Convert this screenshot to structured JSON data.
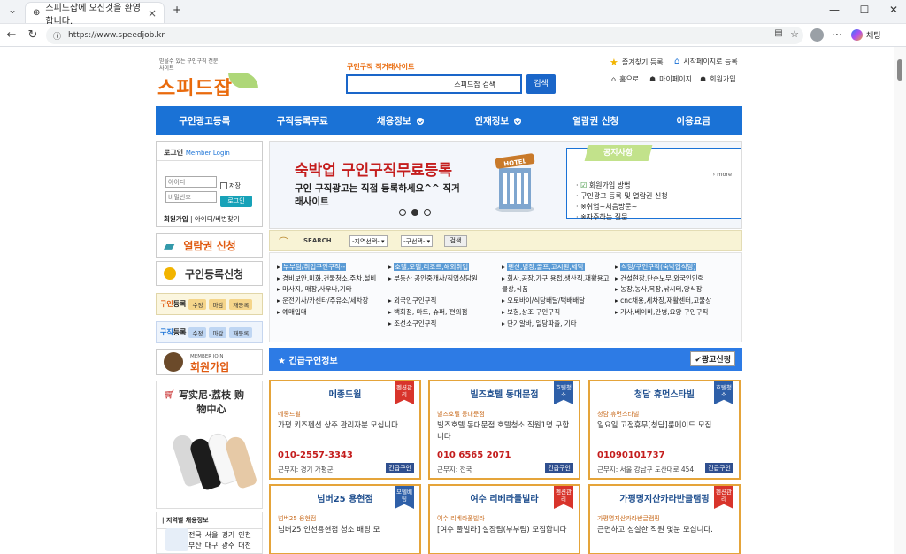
{
  "browser": {
    "tab_title": "스피드잡에 오신것을 환영합니다.",
    "url": "https://www.speedjob.kr",
    "copilot_label": "채팅"
  },
  "header": {
    "logo_tagline": "믿을수 있는 구인구직 전문사이트",
    "logo_text": "스피드잡",
    "search_slogan": "구인구직 직거래사이트",
    "search_placeholder": "스피드잡 검색",
    "search_button": "검색",
    "links": [
      "즐겨찾기 등록",
      "시작페이지로 등록"
    ],
    "sub_links": [
      "홈으로",
      "마이페이지",
      "회원가입"
    ]
  },
  "nav": [
    "구인광고등록",
    "구직등록무료",
    "채용정보",
    "인재정보",
    "열람권 신청",
    "이용요금"
  ],
  "login": {
    "title": "로그인",
    "title_en": "Member Login",
    "id_placeholder": "아이디",
    "pw_placeholder": "비밀번호",
    "save": "저장",
    "button": "로그인",
    "join": "회원가입",
    "find": "아이디/비번찾기"
  },
  "side": {
    "view_pass": "열람권 신청",
    "job_seek": "구인등록신청",
    "job_row": {
      "label_a": "구인",
      "label_b": "등록",
      "chips": [
        "수정",
        "마감",
        "재등록"
      ]
    },
    "seek_row": {
      "label_a": "구직",
      "label_b": "등록",
      "chips": [
        "수정",
        "마감",
        "재등록"
      ]
    },
    "member_join_en": "MEMBER JOIN",
    "member_join": "회원가입",
    "promo_title": "写实尼·荔枝 购物中心",
    "region_title": "지역별 채용정보",
    "regions": [
      "전국",
      "서울",
      "경기",
      "인천",
      "부산",
      "대구",
      "광주",
      "대전"
    ]
  },
  "banner": {
    "headline_a": "숙박업 구인구직",
    "headline_b": "무료등록",
    "sub": "구인 구직광고는 직접 등록하세요^^ 직거래사이트",
    "hotel_sign": "HOTEL"
  },
  "notice": {
    "tag": "공지사항",
    "more": "› more",
    "items": [
      "회원가입 방법",
      "구인광고 등록 및 열람권 신청",
      "※취업~처음방문~",
      "※자주하는 질문"
    ]
  },
  "search": {
    "label": "SEARCH",
    "region": "-지역선택-",
    "district": "-구선택-",
    "button": "검색"
  },
  "categories": {
    "col1": [
      "부부팀/취업구인구직--",
      "경비보안,미화,건물청소,주차,설비",
      "마사지, 매장,사우나,기타",
      "운전기사/카센타/주유소/세차장",
      "예매입대"
    ],
    "col2": [
      "호텔,모텔,리조트,해외취업",
      "부동산 공인중개사/직업상담원",
      "외국인구인구직",
      "백화점, 마트, 슈퍼, 편의점",
      "조선소구인구직"
    ],
    "col3": [
      "펜션,별장,골프,고시원,세탁",
      "회사,공장,가구,용접,생산직,재활용고물상,식품",
      "오토바이/식당배달/택배배달",
      "보험,상조 구인구직",
      "단기알바, 일당파출, 기타"
    ],
    "col4": [
      "식당/구인구직(숙박업식당)",
      "건설현장,단순노무,외국인인력",
      "농장,농사,목장,낚시터,양식장",
      "cnc채용,세차장,재활센터,고물상",
      "가사,베이비,간병,요양 구인구직"
    ]
  },
  "urgent": {
    "title": "긴급구인정보",
    "ad_button": "광고신청"
  },
  "cards": [
    {
      "name": "메종드윌",
      "ribbon": "펜션관리",
      "company": "메종드윌",
      "desc": "가평 키즈펜션 상주 관리자분 모십니다",
      "phone": "010-2557-3343",
      "loc": "근무지: 경기 가평군",
      "btn": "긴급구인",
      "color": "#d8342b"
    },
    {
      "name": "빌즈호텔 동대문점",
      "ribbon": "호텔청소",
      "company": "빌즈호텔 동대문점",
      "desc": "빌즈호텔 동대문점 호텔청소 직원1명 구합니다",
      "phone": "010 6565 2071",
      "loc": "근무지: 전국",
      "btn": "긴급구인",
      "color": "#2e5fa8"
    },
    {
      "name": "청담 휴먼스타빌",
      "ribbon": "호텔청소",
      "company": "청담 휴먼스타빌",
      "desc": "일요일 고정휴무[청담]룸메이드 모집",
      "phone": "01090101737",
      "loc": "근무지: 서울 강남구 도산대로 454",
      "btn": "긴급구인",
      "color": "#2e5fa8"
    },
    {
      "name": "넘버25 용현점",
      "ribbon": "모텔배팅",
      "company": "넘버25 용현점",
      "desc": "넘버25 인천용현점 청소 배팅 모",
      "phone": "",
      "loc": "",
      "btn": "",
      "color": "#2e5fa8"
    },
    {
      "name": "여수 리베라풀빌라",
      "ribbon": "펜션관리",
      "company": "여수 리베라풀빌라",
      "desc": "[여수 풀빌라] 실장팀(부부팀) 모집합니다",
      "phone": "",
      "loc": "",
      "btn": "",
      "color": "#d8342b"
    },
    {
      "name": "가평명지산카라반글램핑",
      "ribbon": "펜션관리",
      "company": "가평명지산카라반글램핑",
      "desc": "근면하고 성실한 직원 몇분 모십니다.",
      "phone": "",
      "loc": "",
      "btn": "",
      "color": "#d8342b"
    }
  ],
  "colors": {
    "brand_blue": "#1a72d6",
    "brand_orange": "#e96a0c"
  }
}
